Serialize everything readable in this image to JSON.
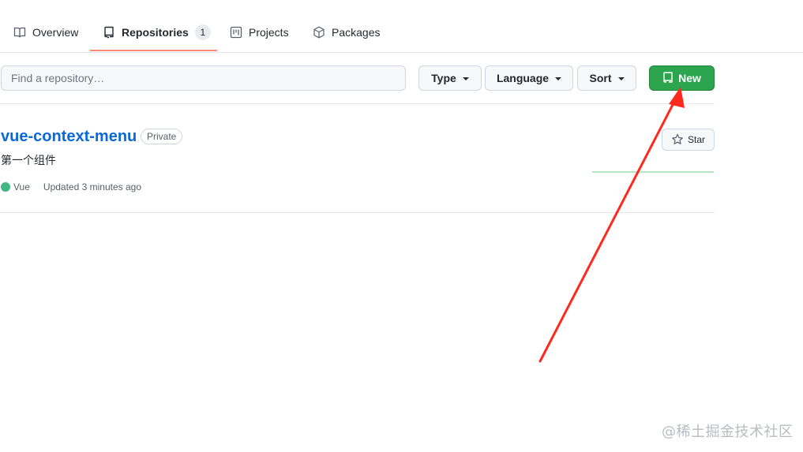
{
  "tabs": [
    {
      "label": "Overview",
      "icon": "book-icon"
    },
    {
      "label": "Repositories",
      "icon": "repo-icon",
      "count": "1",
      "active": true
    },
    {
      "label": "Projects",
      "icon": "project-icon"
    },
    {
      "label": "Packages",
      "icon": "package-icon"
    }
  ],
  "filters": {
    "search_placeholder": "Find a repository…",
    "type_label": "Type",
    "language_label": "Language",
    "sort_label": "Sort",
    "new_label": "New"
  },
  "repo": {
    "name": "vue-context-menu",
    "visibility": "Private",
    "description": "第一个组件",
    "language": "Vue",
    "language_color": "#41b883",
    "updated": "Updated 3 minutes ago",
    "star_label": "Star"
  },
  "colors": {
    "accent_green": "#2da44e",
    "link_blue": "#0969da",
    "tab_underline": "#fd8c73",
    "annotation_red": "#ff2a1f"
  },
  "watermark": "@稀土掘金技术社区"
}
